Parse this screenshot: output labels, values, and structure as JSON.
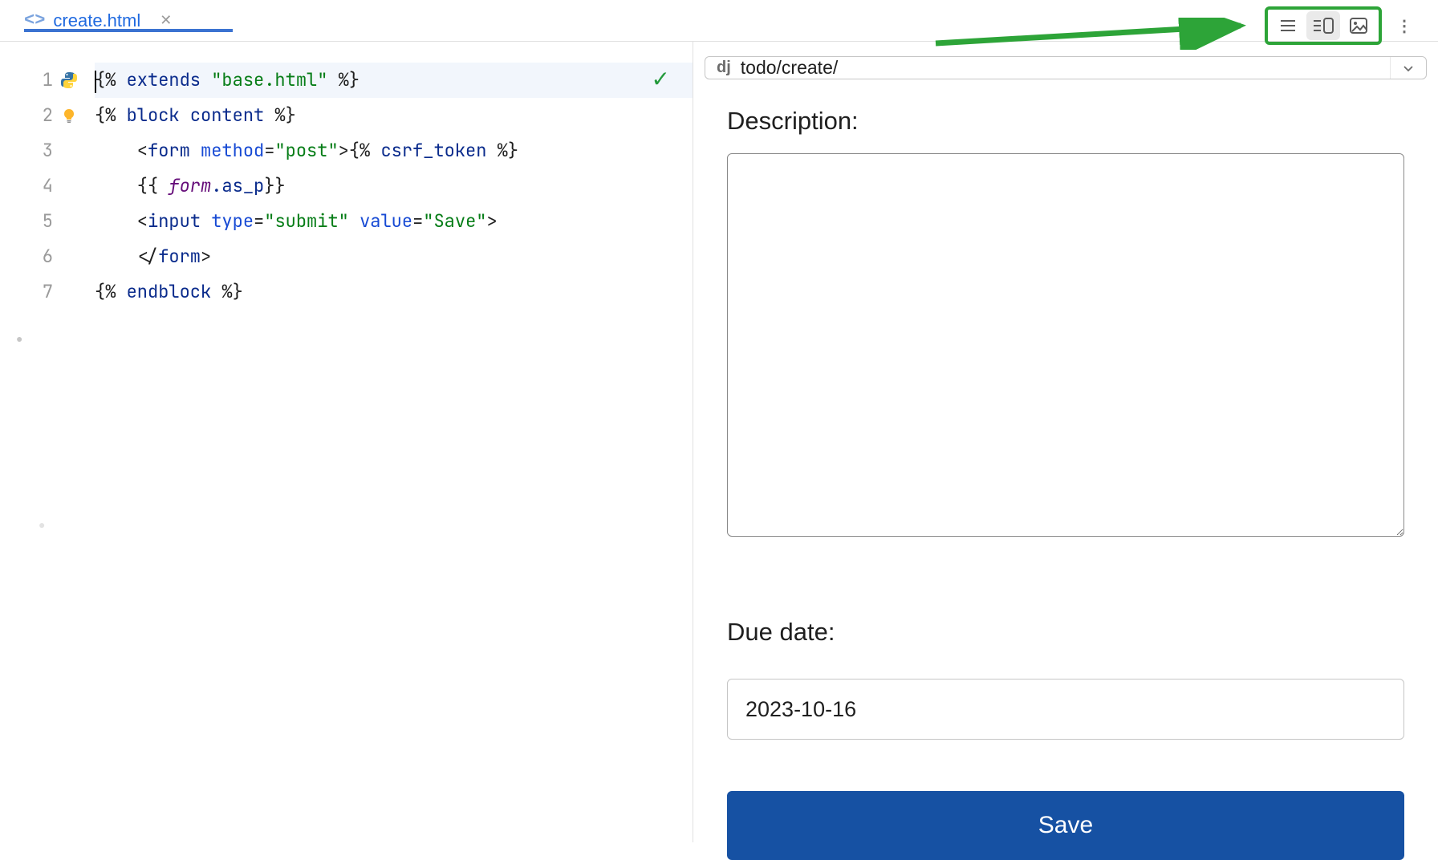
{
  "tab": {
    "filename": "create.html"
  },
  "preview": {
    "url": "todo/create/",
    "description_label": "Description:",
    "due_date_label": "Due date:",
    "due_date_value": "2023-10-16",
    "save_label": "Save"
  },
  "editor": {
    "line_numbers": [
      "1",
      "2",
      "3",
      "4",
      "5",
      "6",
      "7"
    ],
    "code": {
      "l1": {
        "extends": "extends",
        "str": "\"base.html\""
      },
      "l2": {
        "block": "block",
        "content": "content"
      },
      "l3": {
        "form": "form",
        "method_attr": "method",
        "method_val": "\"post\"",
        "csrf": "csrf_token"
      },
      "l4": {
        "form_var": "form",
        "as_p": ".as_p"
      },
      "l5": {
        "input": "input",
        "type_attr": "type",
        "type_val": "\"submit\"",
        "value_attr": "value",
        "value_val": "\"Save\""
      },
      "l6": {
        "form_close": "form"
      },
      "l7": {
        "endblock": "endblock"
      }
    }
  }
}
